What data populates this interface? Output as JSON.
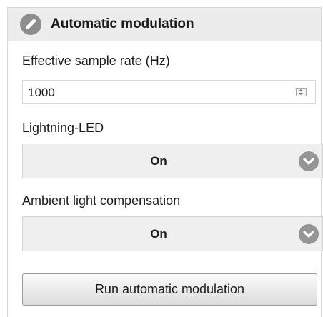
{
  "header": {
    "title": "Automatic modulation",
    "icon": "pencil-icon"
  },
  "sample_rate": {
    "label": "Effective sample rate (Hz)",
    "value": "1000"
  },
  "lightning_led": {
    "label": "Lightning-LED",
    "value": "On"
  },
  "ambient_light": {
    "label": "Ambient light compensation",
    "value": "On"
  },
  "run_button": {
    "label": "Run automatic modulation"
  }
}
